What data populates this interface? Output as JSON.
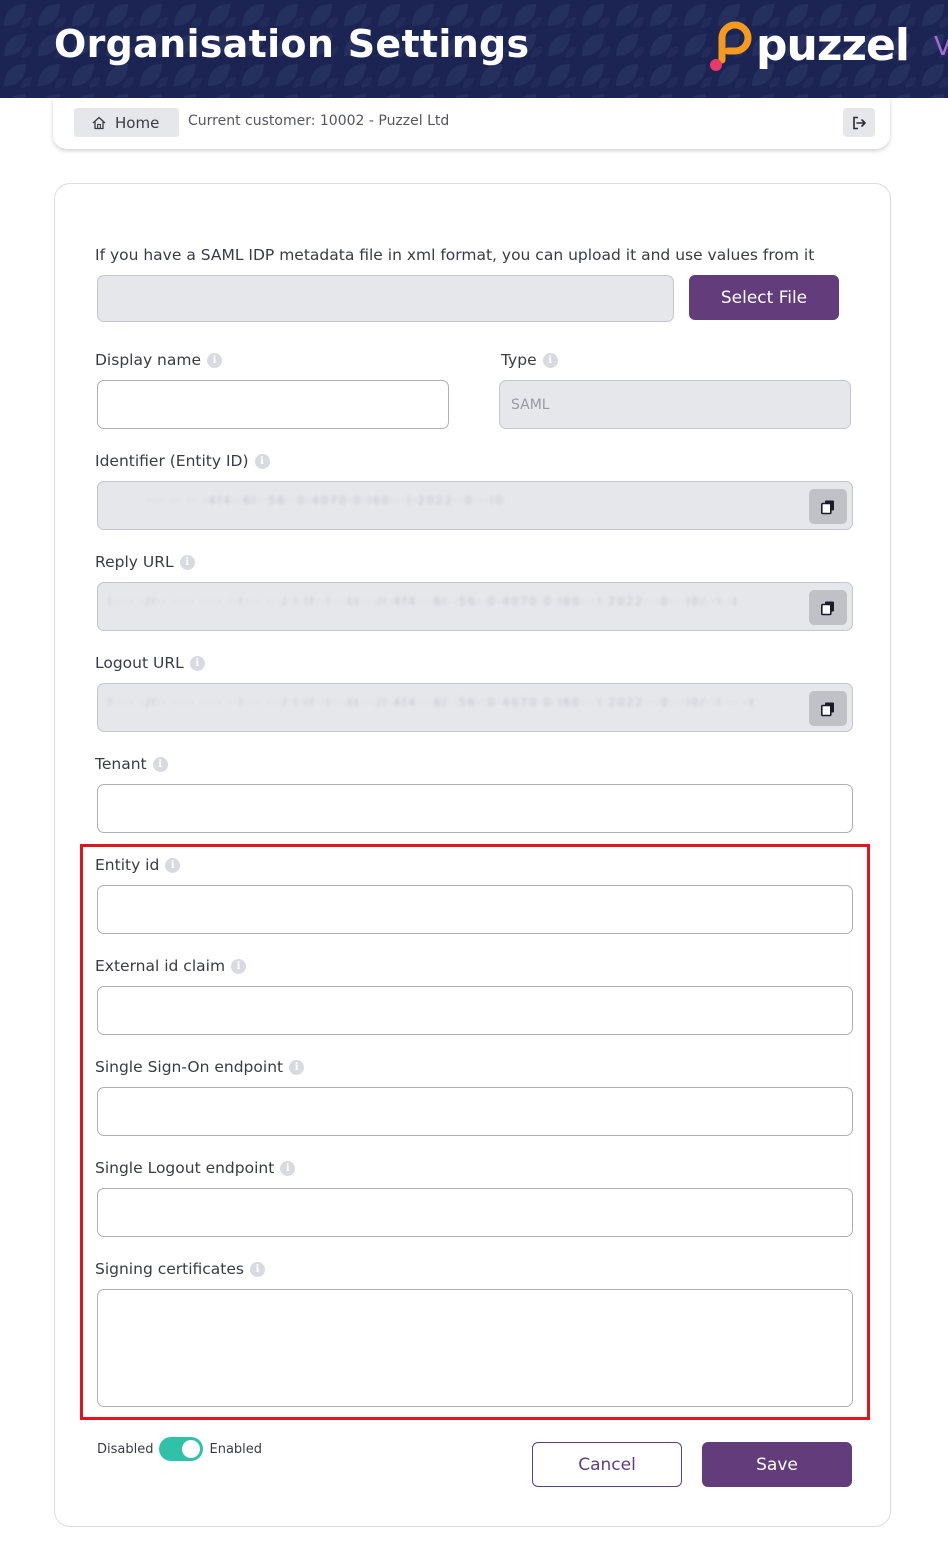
{
  "header": {
    "title": "Organisation Settings",
    "logo_text": "puzzel",
    "edge_glyph": "V"
  },
  "breadcrumb": {
    "home_label": "Home",
    "customer_text": "Current customer: 10002 - Puzzel Ltd"
  },
  "form": {
    "upload_hint": "If you have a SAML IDP metadata file in xml format, you can upload it and use values from it",
    "file_value": "",
    "select_file_label": "Select File",
    "display_name": {
      "label": "Display name",
      "value": ""
    },
    "type": {
      "label": "Type",
      "value": "SAML"
    },
    "identifier": {
      "label": "Identifier (Entity ID)",
      "value": "··· ·· ·· ·4f4··6l··56··0·4070·0·l60···l·2022··0···l0"
    },
    "reply_url": {
      "label": "Reply URL",
      "value": "l···· ·/l·· ···· ···· ··l··· ···/·l·lf··l···tt···/l·4f4···6l··56··0·4070·0·l60···l·2022···0···l0/··l··t"
    },
    "logout_url": {
      "label": "Logout URL",
      "value": "l···· ·/l·· ···· ···· ··l··· ···/·l·lf··l···tt···/l·4f4···6l··56··0·4070·0·l60···l·2022···0···l0/··l··· ·t"
    },
    "tenant": {
      "label": "Tenant",
      "value": ""
    },
    "entity_id": {
      "label": "Entity id",
      "value": ""
    },
    "external_id_claim": {
      "label": "External id claim",
      "value": ""
    },
    "sso_endpoint": {
      "label": "Single Sign-On endpoint",
      "value": ""
    },
    "slo_endpoint": {
      "label": "Single Logout endpoint",
      "value": ""
    },
    "signing_certificates": {
      "label": "Signing certificates",
      "value": ""
    }
  },
  "footer": {
    "toggle_off_label": "Disabled",
    "toggle_on_label": "Enabled",
    "toggle_state": "enabled",
    "cancel_label": "Cancel",
    "save_label": "Save"
  },
  "colors": {
    "header_bg": "#1c2454",
    "brand_purple": "#633c7c",
    "toggle_on": "#2fc2a8",
    "highlight": "#e0161f",
    "logo_orange": "#f39a1f",
    "logo_pink": "#e8396b"
  },
  "icons": {
    "home": "home-icon",
    "logout": "logout-icon",
    "info": "info-icon",
    "copy": "copy-icon"
  }
}
